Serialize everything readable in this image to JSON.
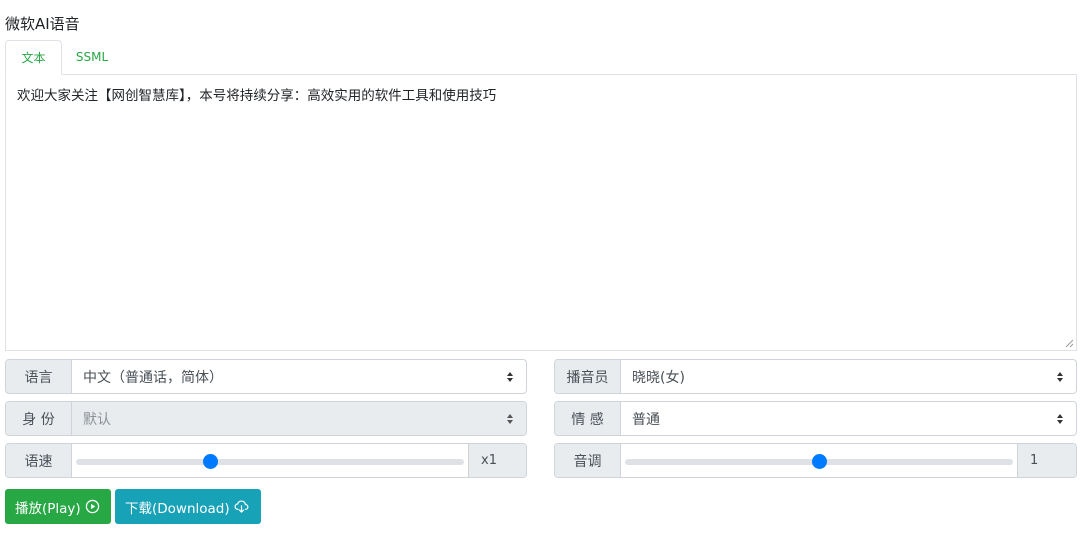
{
  "app": {
    "title": "微软AI语音"
  },
  "tabs": [
    {
      "label": "文本",
      "active": true
    },
    {
      "label": "SSML",
      "active": false
    }
  ],
  "editor": {
    "value": "欢迎大家关注【网创智慧库】，本号将持续分享：高效实用的软件工具和使用技巧"
  },
  "settings": {
    "language": {
      "label": "语言",
      "value": "中文（普通话，简体）"
    },
    "voice": {
      "label": "播音员",
      "value": "晓晓(女)"
    },
    "role": {
      "label": "身 份",
      "value": "默认",
      "disabled": true
    },
    "style": {
      "label": "情 感",
      "value": "普通"
    },
    "rate": {
      "label": "语速",
      "display": "x1",
      "fraction": 0.34
    },
    "pitch": {
      "label": "音调",
      "display": "1",
      "fraction": 0.5
    }
  },
  "actions": {
    "play_label": "播放(Play)",
    "download_label": "下载(Download)"
  },
  "icons": {
    "play": "play-circle-icon",
    "download": "cloud-download-icon",
    "caret": "sort-caret-icon",
    "resize": "resize-grip-icon"
  },
  "colors": {
    "accent_green": "#28a745",
    "accent_teal": "#17a2b8",
    "slider_blue": "#007bff",
    "addon_bg": "#e9ecef",
    "border": "#ced4da"
  }
}
